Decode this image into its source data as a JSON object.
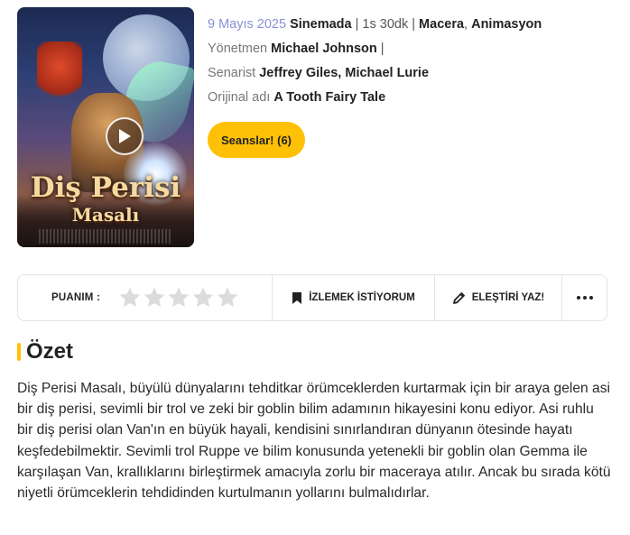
{
  "poster": {
    "title_line1": "Diş Perisi",
    "title_line2": "Masalı",
    "play_icon": "play-icon"
  },
  "info": {
    "date": "9 Mayıs 2025",
    "status": "Sinemada",
    "duration": "1s 30dk",
    "genres": [
      "Macera",
      "Animasyon"
    ],
    "director_label": "Yönetmen",
    "director": "Michael Johnson",
    "writer_label": "Senarist",
    "writers": [
      "Jeffrey Giles",
      "Michael Lurie"
    ],
    "original_title_label": "Orijinal adı",
    "original_title": "A Tooth Fairy Tale"
  },
  "showtimes_label": "Seanslar! (6)",
  "actions": {
    "rating_label": "PUANIM :",
    "stars_count": 5,
    "stars_filled": 0,
    "watchlist_label": "İZLEMEK İSTİYORUM",
    "watchlist_icon": "bookmark-icon",
    "review_label": "ELEŞTİRİ YAZ!",
    "review_icon": "pencil-icon",
    "more_icon": "more-dots-icon"
  },
  "summary": {
    "title": "Özet",
    "text": "Diş Perisi Masalı, büyülü dünyalarını tehditkar örümceklerden kurtarmak için bir araya gelen asi bir diş perisi, sevimli bir trol ve zeki bir goblin bilim adamının hikayesini konu ediyor. Asi ruhlu bir diş perisi olan Van'ın en büyük hayali, kendisini sınırlandıran dünyanın ötesinde hayatı keşfedebilmektir. Sevimli trol Ruppe ve bilim konusunda yetenekli bir goblin olan Gemma ile karşılaşan Van, krallıklarını birleştirmek amacıyla zorlu bir maceraya atılır. Ancak bu sırada kötü niyetli örümceklerin tehdidinden kurtulmanın yollarını bulmalıdırlar."
  },
  "colors": {
    "accent": "#ffc107",
    "date": "#8a8fd6",
    "star_empty": "#dcdcdc",
    "muted": "#777777"
  }
}
